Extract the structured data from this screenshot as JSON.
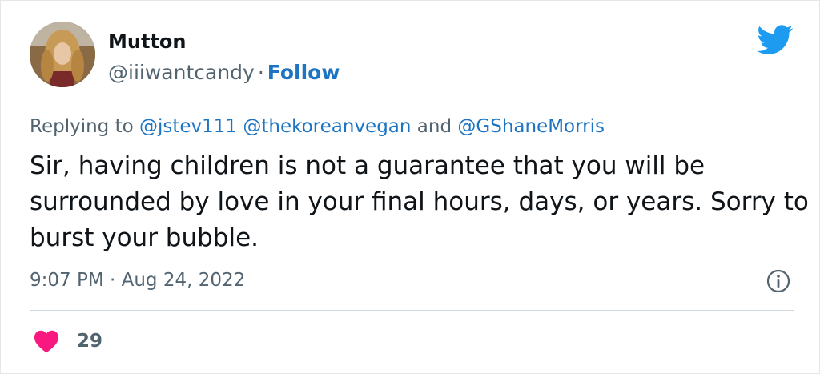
{
  "user": {
    "display_name": "Mutton",
    "handle": "@iiiwantcandy",
    "separator": "·",
    "follow_label": "Follow"
  },
  "reply": {
    "prefix": "Replying to",
    "mentions": [
      "@jstev111",
      "@thekoreanvegan"
    ],
    "conjunction": "and",
    "last_mention": "@GShaneMorris"
  },
  "tweet": {
    "text": "Sir, having children is not a guarantee that you will be surrounded by love in your final hours, days, or years. Sorry to burst your bubble.",
    "timestamp": "9:07 PM · Aug 24, 2022"
  },
  "engagement": {
    "like_count": "29"
  },
  "icons": {
    "brand": "twitter-bird-icon",
    "info": "info-icon",
    "like": "heart-icon"
  },
  "colors": {
    "link": "#1d74c2",
    "muted": "#536471",
    "twitter_blue": "#1d9bf0",
    "heart": "#f91880",
    "text": "#0f1419"
  }
}
